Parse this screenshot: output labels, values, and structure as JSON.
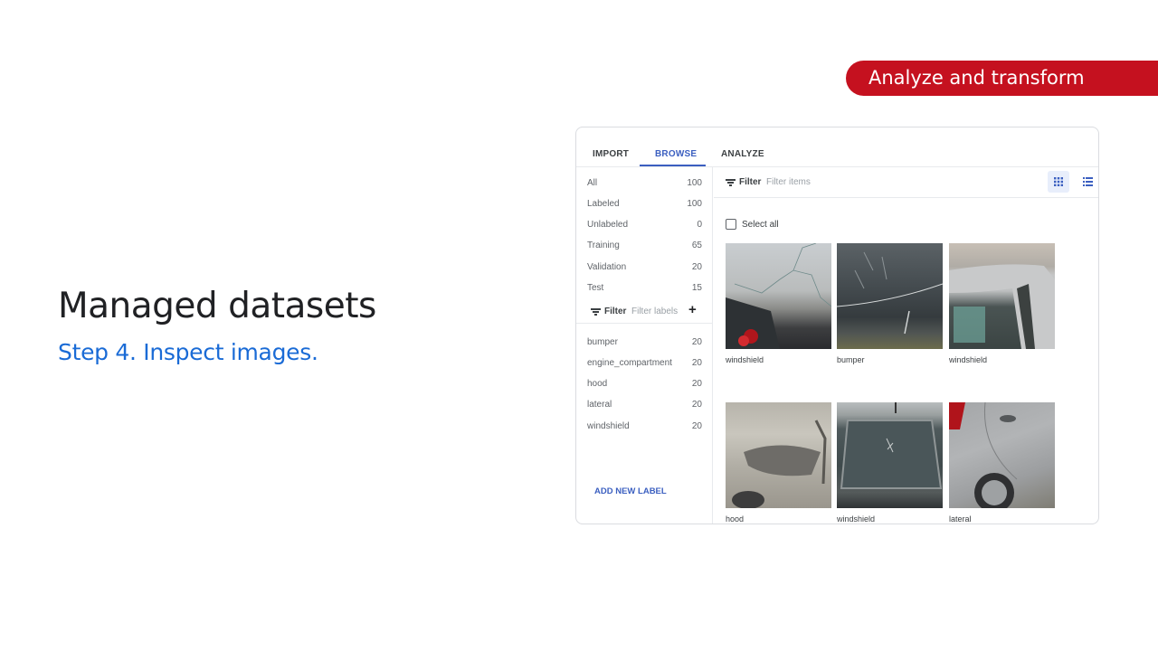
{
  "section_pill": "Analyze and transform",
  "title": "Managed datasets",
  "subtitle": "Step 4. Inspect images.",
  "tabs": [
    {
      "label": "IMPORT",
      "active": false
    },
    {
      "label": "BROWSE",
      "active": true
    },
    {
      "label": "ANALYZE",
      "active": false
    }
  ],
  "sidebar": {
    "splits": [
      {
        "label": "All",
        "count": "100"
      },
      {
        "label": "Labeled",
        "count": "100"
      },
      {
        "label": "Unlabeled",
        "count": "0"
      },
      {
        "label": "Training",
        "count": "65"
      },
      {
        "label": "Validation",
        "count": "20"
      },
      {
        "label": "Test",
        "count": "15"
      }
    ],
    "filter_label": "Filter",
    "filter_placeholder": "Filter labels",
    "add_icon": "plus-icon",
    "labels": [
      {
        "label": "bumper",
        "count": "20"
      },
      {
        "label": "engine_compartment",
        "count": "20"
      },
      {
        "label": "hood",
        "count": "20"
      },
      {
        "label": "lateral",
        "count": "20"
      },
      {
        "label": "windshield",
        "count": "20"
      }
    ],
    "add_new_label": "ADD NEW LABEL"
  },
  "main": {
    "filter_label": "Filter",
    "filter_placeholder": "Filter items",
    "view_icons": [
      "grid-view-icon",
      "list-view-icon"
    ],
    "select_all": "Select all",
    "images": [
      {
        "label": "windshield",
        "scene": "cracked windshield view from inside car"
      },
      {
        "label": "bumper",
        "scene": "scratched dark bumper"
      },
      {
        "label": "windshield",
        "scene": "silver car roof and windshield"
      },
      {
        "label": "hood",
        "scene": "damaged silver hood and headlight"
      },
      {
        "label": "windshield",
        "scene": "cracked front windshield"
      },
      {
        "label": "lateral",
        "scene": "dented silver car side"
      }
    ]
  },
  "colors": {
    "accent": "#3b5fc0",
    "pill": "#c5111f",
    "subtitle": "#1a6bd6"
  }
}
